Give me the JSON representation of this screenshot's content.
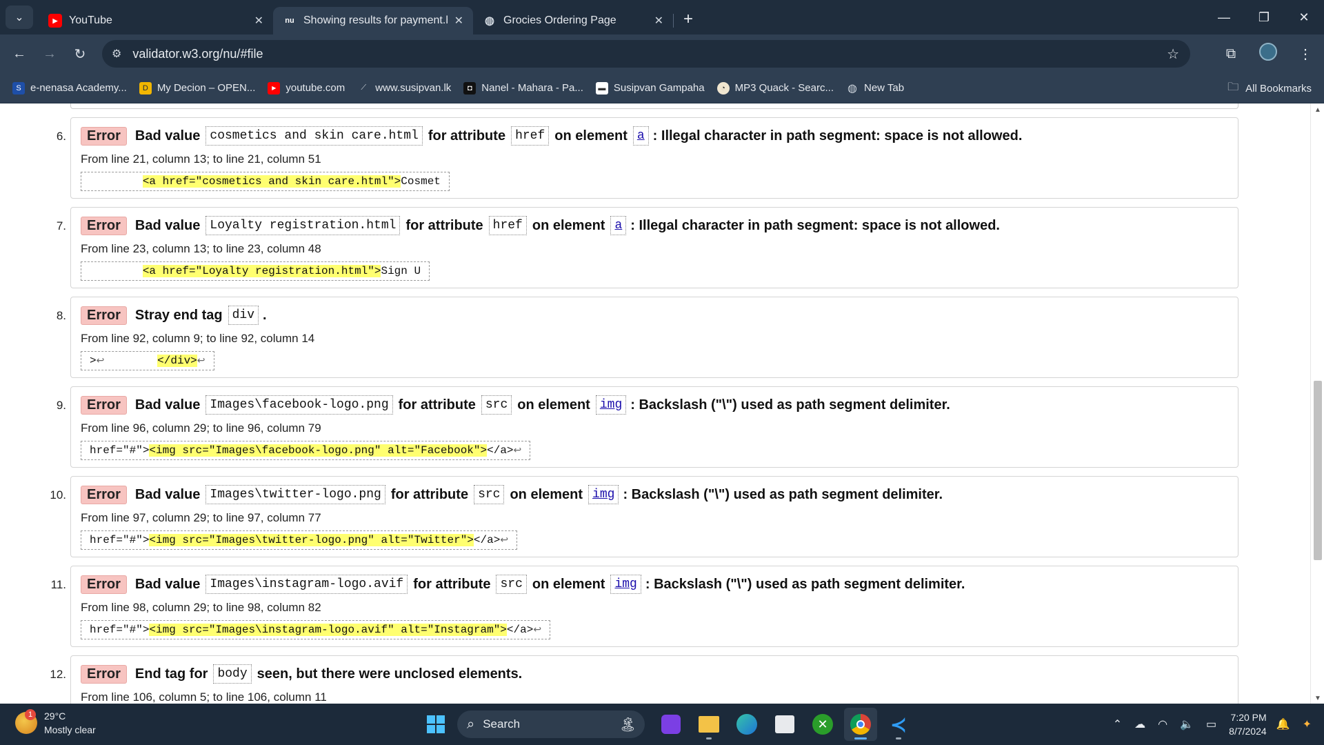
{
  "browser": {
    "tabs": [
      {
        "title": "YouTube",
        "favicon": "youtube-icon",
        "active": false
      },
      {
        "title": "Showing results for payment.ht",
        "favicon": "nu-validator-icon",
        "favicon_text": "nu",
        "active": true
      },
      {
        "title": "Grocies Ordering Page",
        "favicon": "globe-icon",
        "active": false
      }
    ],
    "url": "validator.w3.org/nu/#file",
    "bookmarks": [
      {
        "label": "e-nenasa Academy...",
        "icon": "enenasa-icon"
      },
      {
        "label": "My Decion – OPEN...",
        "icon": "decion-icon"
      },
      {
        "label": "youtube.com",
        "icon": "youtube-icon"
      },
      {
        "label": "www.susipvan.lk",
        "icon": "susipvan-icon"
      },
      {
        "label": "Nanel - Mahara - Pa...",
        "icon": "nanel-icon"
      },
      {
        "label": "Susipvan Gampaha",
        "icon": "susipvan-gampaha-icon"
      },
      {
        "label": "MP3 Quack - Searc...",
        "icon": "mp3quack-icon"
      },
      {
        "label": "New Tab",
        "icon": "globe-icon"
      }
    ],
    "all_bookmarks": "All Bookmarks"
  },
  "messages": [
    {
      "num": "6.",
      "type": "Error",
      "parts": [
        {
          "t": "text",
          "v": "Bad value"
        },
        {
          "t": "code",
          "v": "cosmetics and skin care.html"
        },
        {
          "t": "text",
          "v": "for attribute"
        },
        {
          "t": "code",
          "v": "href"
        },
        {
          "t": "text",
          "v": "on element"
        },
        {
          "t": "link",
          "v": "a"
        },
        {
          "t": "text",
          "v": ": Illegal character in path segment: space is not allowed."
        }
      ],
      "location": "From line 21, column 13; to line 21, column 51",
      "extract": [
        {
          "t": "plain",
          "v": "        "
        },
        {
          "t": "hl",
          "v": "<a href=\"cosmetics and skin care.html\">"
        },
        {
          "t": "plain",
          "v": "Cosmet"
        }
      ]
    },
    {
      "num": "7.",
      "type": "Error",
      "parts": [
        {
          "t": "text",
          "v": "Bad value"
        },
        {
          "t": "code",
          "v": "Loyalty registration.html"
        },
        {
          "t": "text",
          "v": "for attribute"
        },
        {
          "t": "code",
          "v": "href"
        },
        {
          "t": "text",
          "v": "on element"
        },
        {
          "t": "link",
          "v": "a"
        },
        {
          "t": "text",
          "v": ": Illegal character in path segment: space is not allowed."
        }
      ],
      "location": "From line 23, column 13; to line 23, column 48",
      "extract": [
        {
          "t": "plain",
          "v": "        "
        },
        {
          "t": "hl",
          "v": "<a href=\"Loyalty registration.html\">"
        },
        {
          "t": "plain",
          "v": "Sign U"
        }
      ]
    },
    {
      "num": "8.",
      "type": "Error",
      "parts": [
        {
          "t": "text",
          "v": "Stray end tag"
        },
        {
          "t": "code",
          "v": "div"
        },
        {
          "t": "text",
          "v": "."
        }
      ],
      "location": "From line 92, column 9; to line 92, column 14",
      "extract": [
        {
          "t": "plain",
          "v": ">"
        },
        {
          "t": "lf",
          "v": "↩"
        },
        {
          "t": "plain",
          "v": "        "
        },
        {
          "t": "hl",
          "v": "</div>"
        },
        {
          "t": "lf",
          "v": "↩"
        }
      ]
    },
    {
      "num": "9.",
      "type": "Error",
      "parts": [
        {
          "t": "text",
          "v": "Bad value"
        },
        {
          "t": "code",
          "v": "Images\\facebook-logo.png"
        },
        {
          "t": "text",
          "v": "for attribute"
        },
        {
          "t": "code",
          "v": "src"
        },
        {
          "t": "text",
          "v": "on element"
        },
        {
          "t": "link",
          "v": "img"
        },
        {
          "t": "text",
          "v": ": Backslash (\"\\\") used as path segment delimiter."
        }
      ],
      "location": "From line 96, column 29; to line 96, column 79",
      "extract": [
        {
          "t": "plain",
          "v": "href=\"#\">"
        },
        {
          "t": "hl",
          "v": "<img src=\"Images\\facebook-logo.png\" alt=\"Facebook\">"
        },
        {
          "t": "plain",
          "v": "</a>"
        },
        {
          "t": "lf",
          "v": "↩"
        }
      ]
    },
    {
      "num": "10.",
      "type": "Error",
      "parts": [
        {
          "t": "text",
          "v": "Bad value"
        },
        {
          "t": "code",
          "v": "Images\\twitter-logo.png"
        },
        {
          "t": "text",
          "v": "for attribute"
        },
        {
          "t": "code",
          "v": "src"
        },
        {
          "t": "text",
          "v": "on element"
        },
        {
          "t": "link",
          "v": "img"
        },
        {
          "t": "text",
          "v": ": Backslash (\"\\\") used as path segment delimiter."
        }
      ],
      "location": "From line 97, column 29; to line 97, column 77",
      "extract": [
        {
          "t": "plain",
          "v": "href=\"#\">"
        },
        {
          "t": "hl",
          "v": "<img src=\"Images\\twitter-logo.png\" alt=\"Twitter\">"
        },
        {
          "t": "plain",
          "v": "</a>"
        },
        {
          "t": "lf",
          "v": "↩"
        }
      ]
    },
    {
      "num": "11.",
      "type": "Error",
      "parts": [
        {
          "t": "text",
          "v": "Bad value"
        },
        {
          "t": "code",
          "v": "Images\\instagram-logo.avif"
        },
        {
          "t": "text",
          "v": "for attribute"
        },
        {
          "t": "code",
          "v": "src"
        },
        {
          "t": "text",
          "v": "on element"
        },
        {
          "t": "link",
          "v": "img"
        },
        {
          "t": "text",
          "v": ": Backslash (\"\\\") used as path segment delimiter."
        }
      ],
      "location": "From line 98, column 29; to line 98, column 82",
      "extract": [
        {
          "t": "plain",
          "v": "href=\"#\">"
        },
        {
          "t": "hl",
          "v": "<img src=\"Images\\instagram-logo.avif\" alt=\"Instagram\">"
        },
        {
          "t": "plain",
          "v": "</a>"
        },
        {
          "t": "lf",
          "v": "↩"
        }
      ]
    },
    {
      "num": "12.",
      "type": "Error",
      "parts": [
        {
          "t": "text",
          "v": "End tag for"
        },
        {
          "t": "code",
          "v": "body"
        },
        {
          "t": "text",
          "v": "seen, but there were unclosed elements."
        }
      ],
      "location": "From line 106, column 5; to line 106, column 11",
      "extract": []
    }
  ],
  "taskbar": {
    "weather_temp": "29°C",
    "weather_desc": "Mostly clear",
    "weather_badge": "1",
    "search_label": "Search",
    "apps": [
      "start-icon",
      "copilot-icon",
      "file-explorer-icon",
      "edge-icon",
      "store-icon",
      "xbox-icon",
      "chrome-icon",
      "vscode-icon"
    ],
    "time": "7:20 PM",
    "date": "8/7/2024"
  },
  "colors": {
    "error_badge": "#f7c4c1",
    "highlight": "#ffff70",
    "link": "#1a0dab",
    "chrome_dark": "#1f2d3d"
  }
}
